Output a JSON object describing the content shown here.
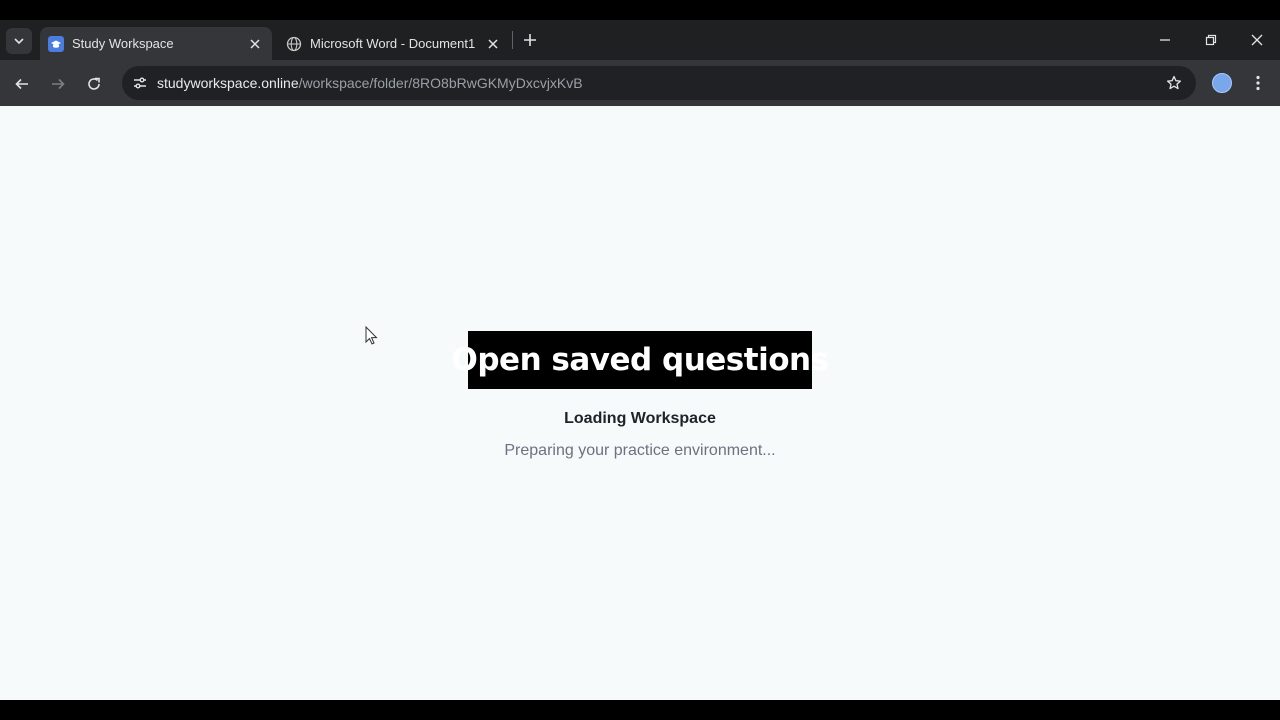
{
  "browser": {
    "tabs": [
      {
        "title": "Study Workspace",
        "active": true,
        "favicon": "graduation-cap-icon"
      },
      {
        "title": "Microsoft Word - Document1",
        "active": false,
        "favicon": "globe-icon"
      }
    ],
    "address_bar": {
      "host": "studyworkspace.online",
      "path": "/workspace/folder/8RO8bRwGKMyDxcvjxKvB"
    }
  },
  "page": {
    "banner": "Open saved questions",
    "loading_title": "Loading Workspace",
    "loading_subtitle": "Preparing your practice environment..."
  },
  "colors": {
    "tabstrip": "#1f2021",
    "toolbar": "#35363a",
    "page_background": "#f7fafb",
    "banner_background": "#000000"
  }
}
